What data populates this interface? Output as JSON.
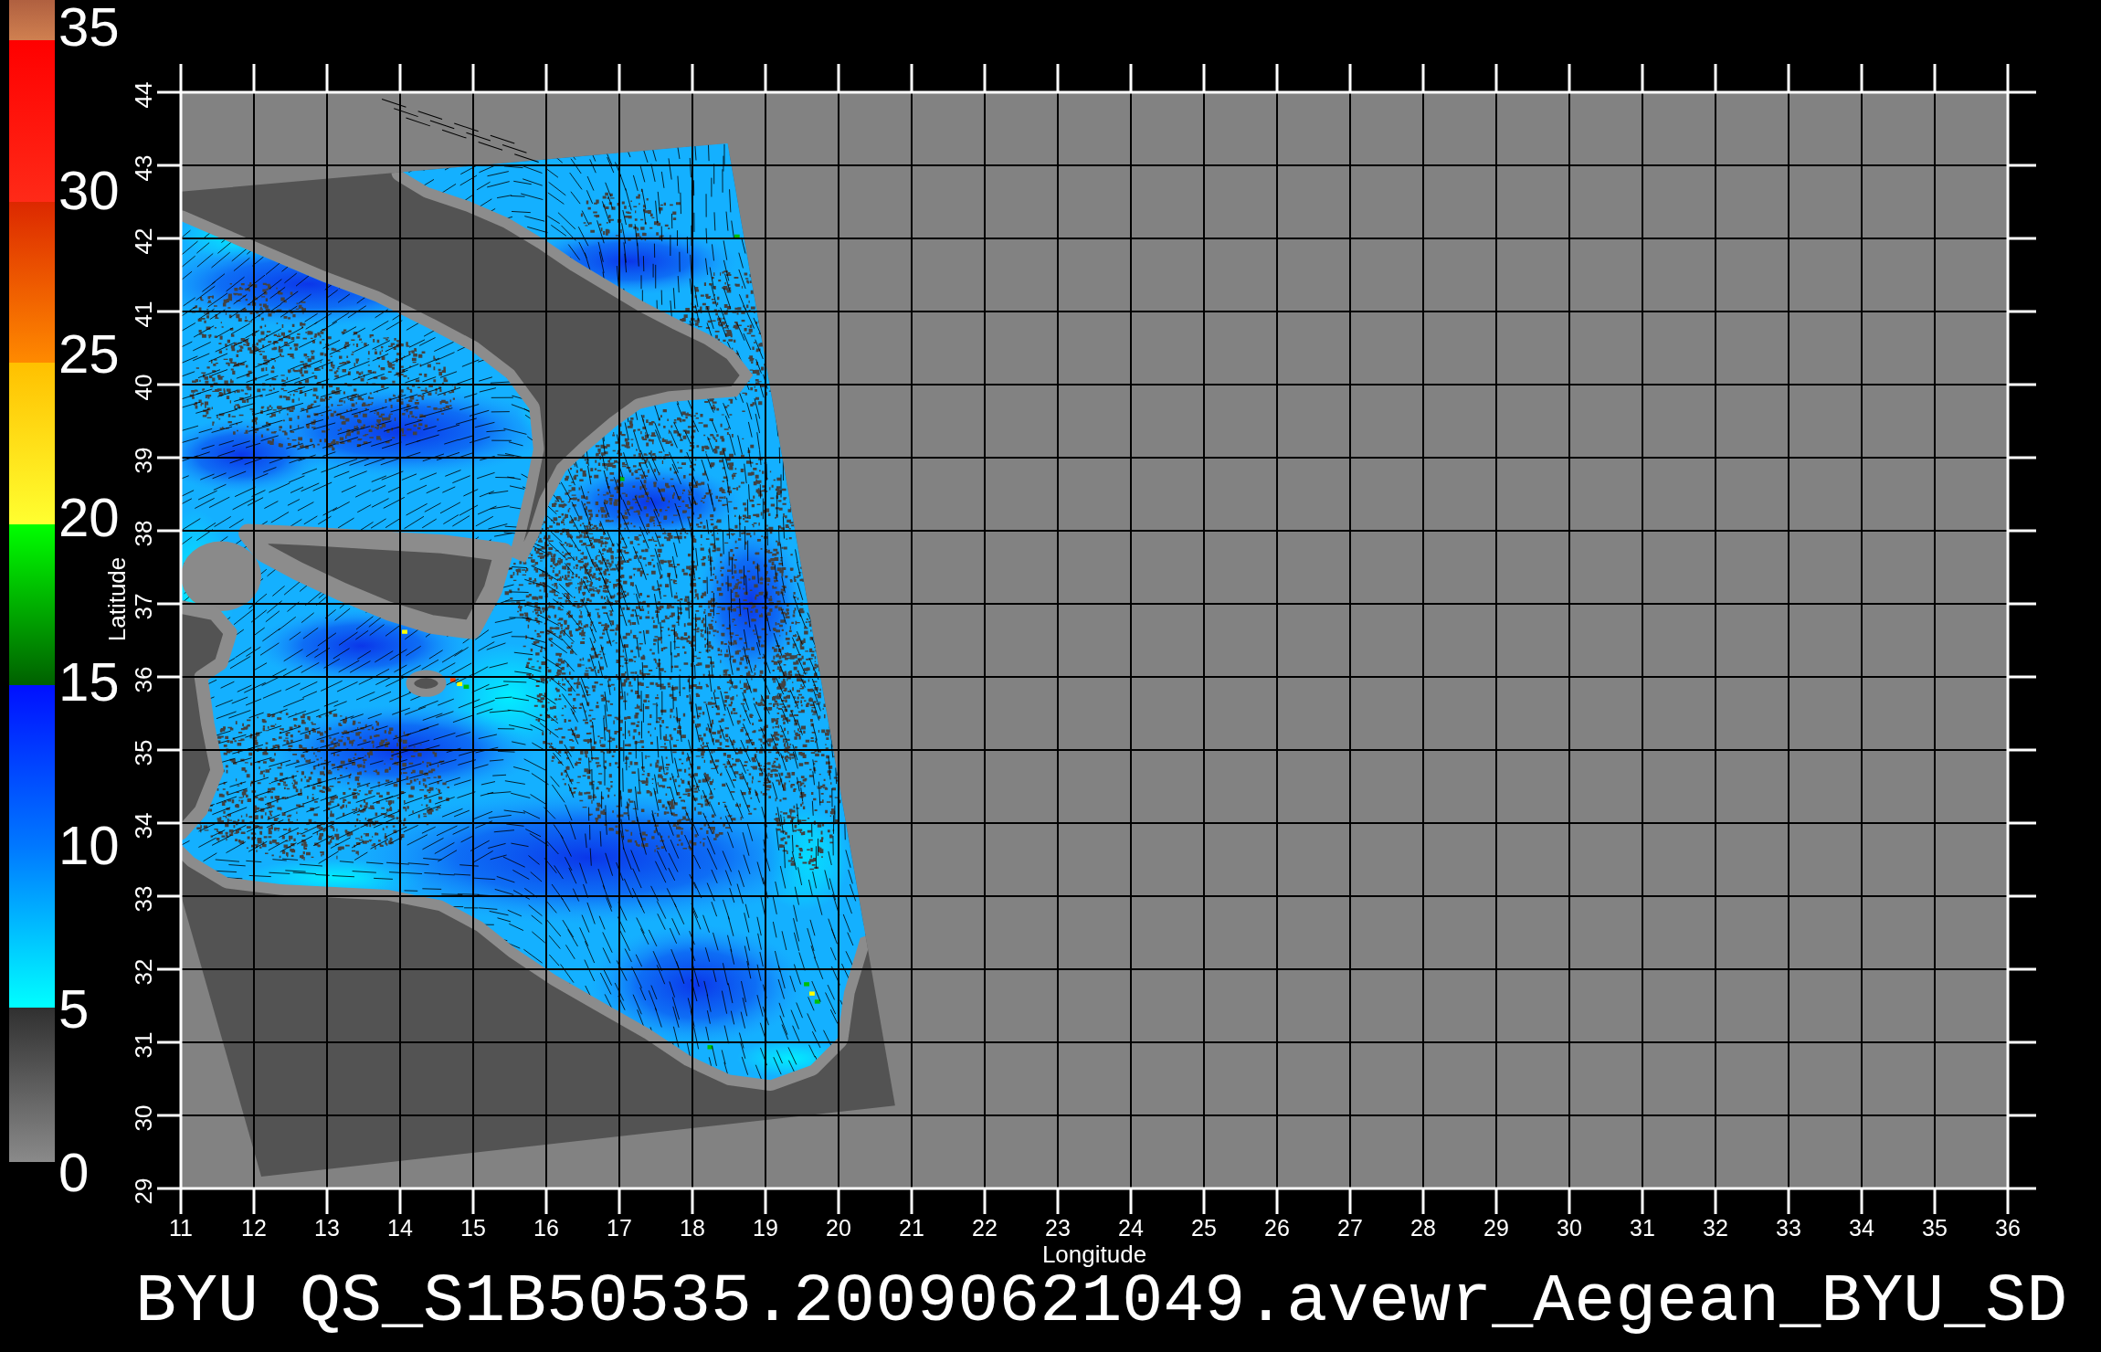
{
  "colorbar": {
    "labels": [
      "35",
      "30",
      "25",
      "20",
      "15",
      "10",
      "5",
      "0"
    ]
  },
  "map": {
    "y_axis": {
      "title": "Latitude",
      "ticks": [
        "44",
        "43",
        "42",
        "41",
        "40",
        "39",
        "38",
        "37",
        "36",
        "35",
        "34",
        "33",
        "32",
        "31",
        "30",
        "29"
      ]
    },
    "x_axis": {
      "title": "Longitude",
      "ticks": [
        "11",
        "12",
        "13",
        "14",
        "15",
        "16",
        "17",
        "18",
        "19",
        "20",
        "21",
        "22",
        "23",
        "24",
        "25",
        "26",
        "27",
        "28",
        "29",
        "30",
        "31",
        "32",
        "33",
        "34",
        "35",
        "36"
      ]
    }
  },
  "title": "BYU QS_S1B50535.20090621049.avewr_Aegean_BYU_SD"
}
